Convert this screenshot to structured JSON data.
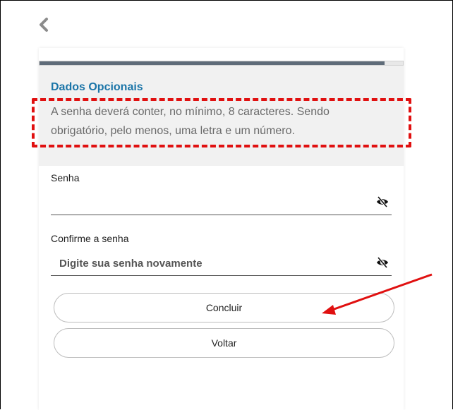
{
  "header": {
    "back_icon": "chevron-left-icon"
  },
  "progress": {
    "value": 0.95
  },
  "info": {
    "title": "Dados Opcionais",
    "text": "A senha deverá conter, no mínimo, 8 caracteres. Sendo obrigatório, pelo menos, uma letra e um número."
  },
  "form": {
    "password": {
      "label": "Senha",
      "value": "",
      "placeholder": "",
      "toggle_icon": "eye-slash-icon"
    },
    "confirm": {
      "label": "Confirme a senha",
      "value": "",
      "placeholder": "Digite sua senha novamente",
      "toggle_icon": "eye-slash-icon"
    }
  },
  "buttons": {
    "conclude_label": "Concluir",
    "back_label": "Voltar"
  },
  "annotations": {
    "highlight_color": "#e01010",
    "arrow_color": "#e01010"
  },
  "colors": {
    "title": "#1b75a8",
    "progress": "#5f6c79",
    "info_bg": "#f1f1f1"
  }
}
